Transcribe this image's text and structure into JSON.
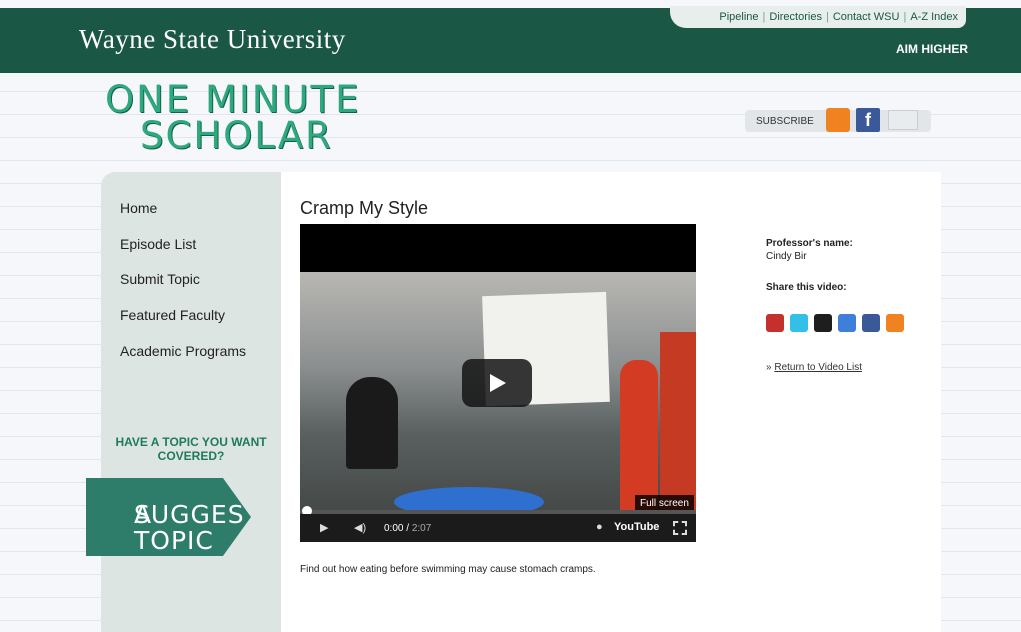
{
  "header": {
    "logo": "Wayne State University",
    "top_links": [
      "Pipeline",
      "Directories",
      "Contact WSU",
      "A-Z Index"
    ],
    "tagline": "AIM HIGHER",
    "bg_color": "#1b5745"
  },
  "site": {
    "title_line1": "ONE MINUTE",
    "title_line2": "SCHOLAR",
    "subscribe_label": "SUBSCRIBE",
    "subscribe_icons": [
      "rss-icon",
      "facebook-icon",
      "email-icon"
    ]
  },
  "sidebar": {
    "nav": [
      "Home",
      "Episode List",
      "Submit Topic",
      "Featured Faculty",
      "Academic Programs"
    ],
    "cta_question": "HAVE A TOPIC YOU WANT COVERED?",
    "suggest_line1": "SUGGEST",
    "suggest_line2": "A TOPIC"
  },
  "main": {
    "video_title": "Cramp My Style",
    "fullscreen_tip": "Full screen",
    "time_current": "0:00",
    "time_duration": "2:07",
    "youtube_label": "YouTube",
    "description": "Find out how eating before swimming may cause stomach cramps."
  },
  "info": {
    "professor_label": "Professor's name:",
    "professor_name": "Cindy Bir",
    "share_label": "Share this video:",
    "share_icons": [
      "youtube-icon",
      "twitter-icon",
      "delicious-icon",
      "myspace-icon",
      "facebook-icon",
      "rss-icon"
    ],
    "return_prefix": "»",
    "return_link": "Return to Video List"
  }
}
